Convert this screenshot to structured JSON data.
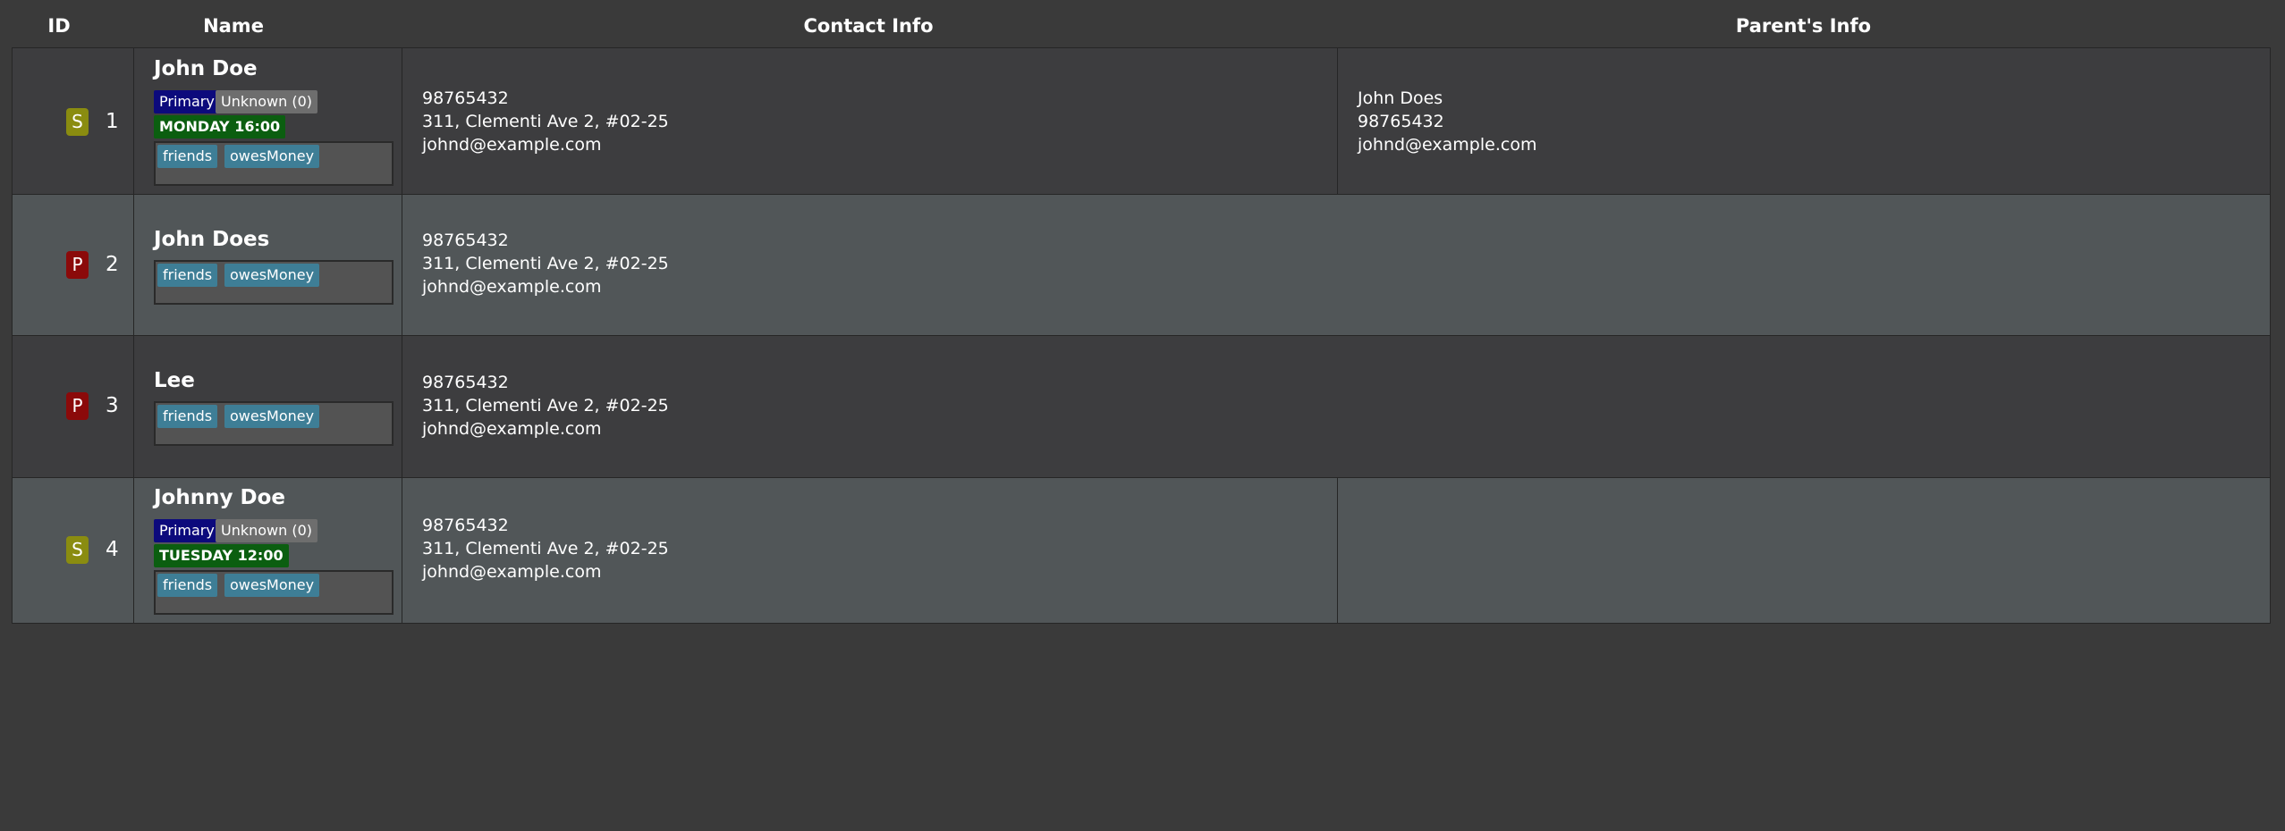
{
  "headers": {
    "id": "ID",
    "name": "Name",
    "contact": "Contact Info",
    "parent": "Parent's Info"
  },
  "rows": [
    {
      "id": "1",
      "role": "S",
      "name": "John Doe",
      "priority": "Primary",
      "status": "Unknown (0)",
      "schedule": "MONDAY 16:00",
      "tags": [
        "friends",
        "owesMoney"
      ],
      "phone": "98765432",
      "address": "311, Clementi Ave 2, #02-25",
      "email": "johnd@example.com",
      "parent": {
        "name": "John Does",
        "phone": "98765432",
        "email": "johnd@example.com"
      }
    },
    {
      "id": "2",
      "role": "P",
      "name": "John Does",
      "tags": [
        "friends",
        "owesMoney"
      ],
      "phone": "98765432",
      "address": "311, Clementi Ave 2, #02-25",
      "email": "johnd@example.com"
    },
    {
      "id": "3",
      "role": "P",
      "name": "Lee",
      "tags": [
        "friends",
        "owesMoney"
      ],
      "phone": "98765432",
      "address": "311, Clementi Ave 2, #02-25",
      "email": "johnd@example.com"
    },
    {
      "id": "4",
      "role": "S",
      "name": "Johnny Doe",
      "priority": "Primary",
      "status": "Unknown (0)",
      "schedule": "TUESDAY 12:00",
      "tags": [
        "friends",
        "owesMoney"
      ],
      "phone": "98765432",
      "address": "311, Clementi Ave 2, #02-25",
      "email": "johnd@example.com"
    }
  ],
  "colors": {
    "background": "#3a3a3a",
    "row_dark": "#3d3d3f",
    "row_light": "#515658",
    "student_badge": "#8a8c10",
    "parent_badge": "#8b0a0a",
    "primary_tag": "#0c0a7c",
    "unknown_tag": "#6e6e6e",
    "schedule_tag": "#0b5e10",
    "label_chip": "#3e7e96"
  }
}
